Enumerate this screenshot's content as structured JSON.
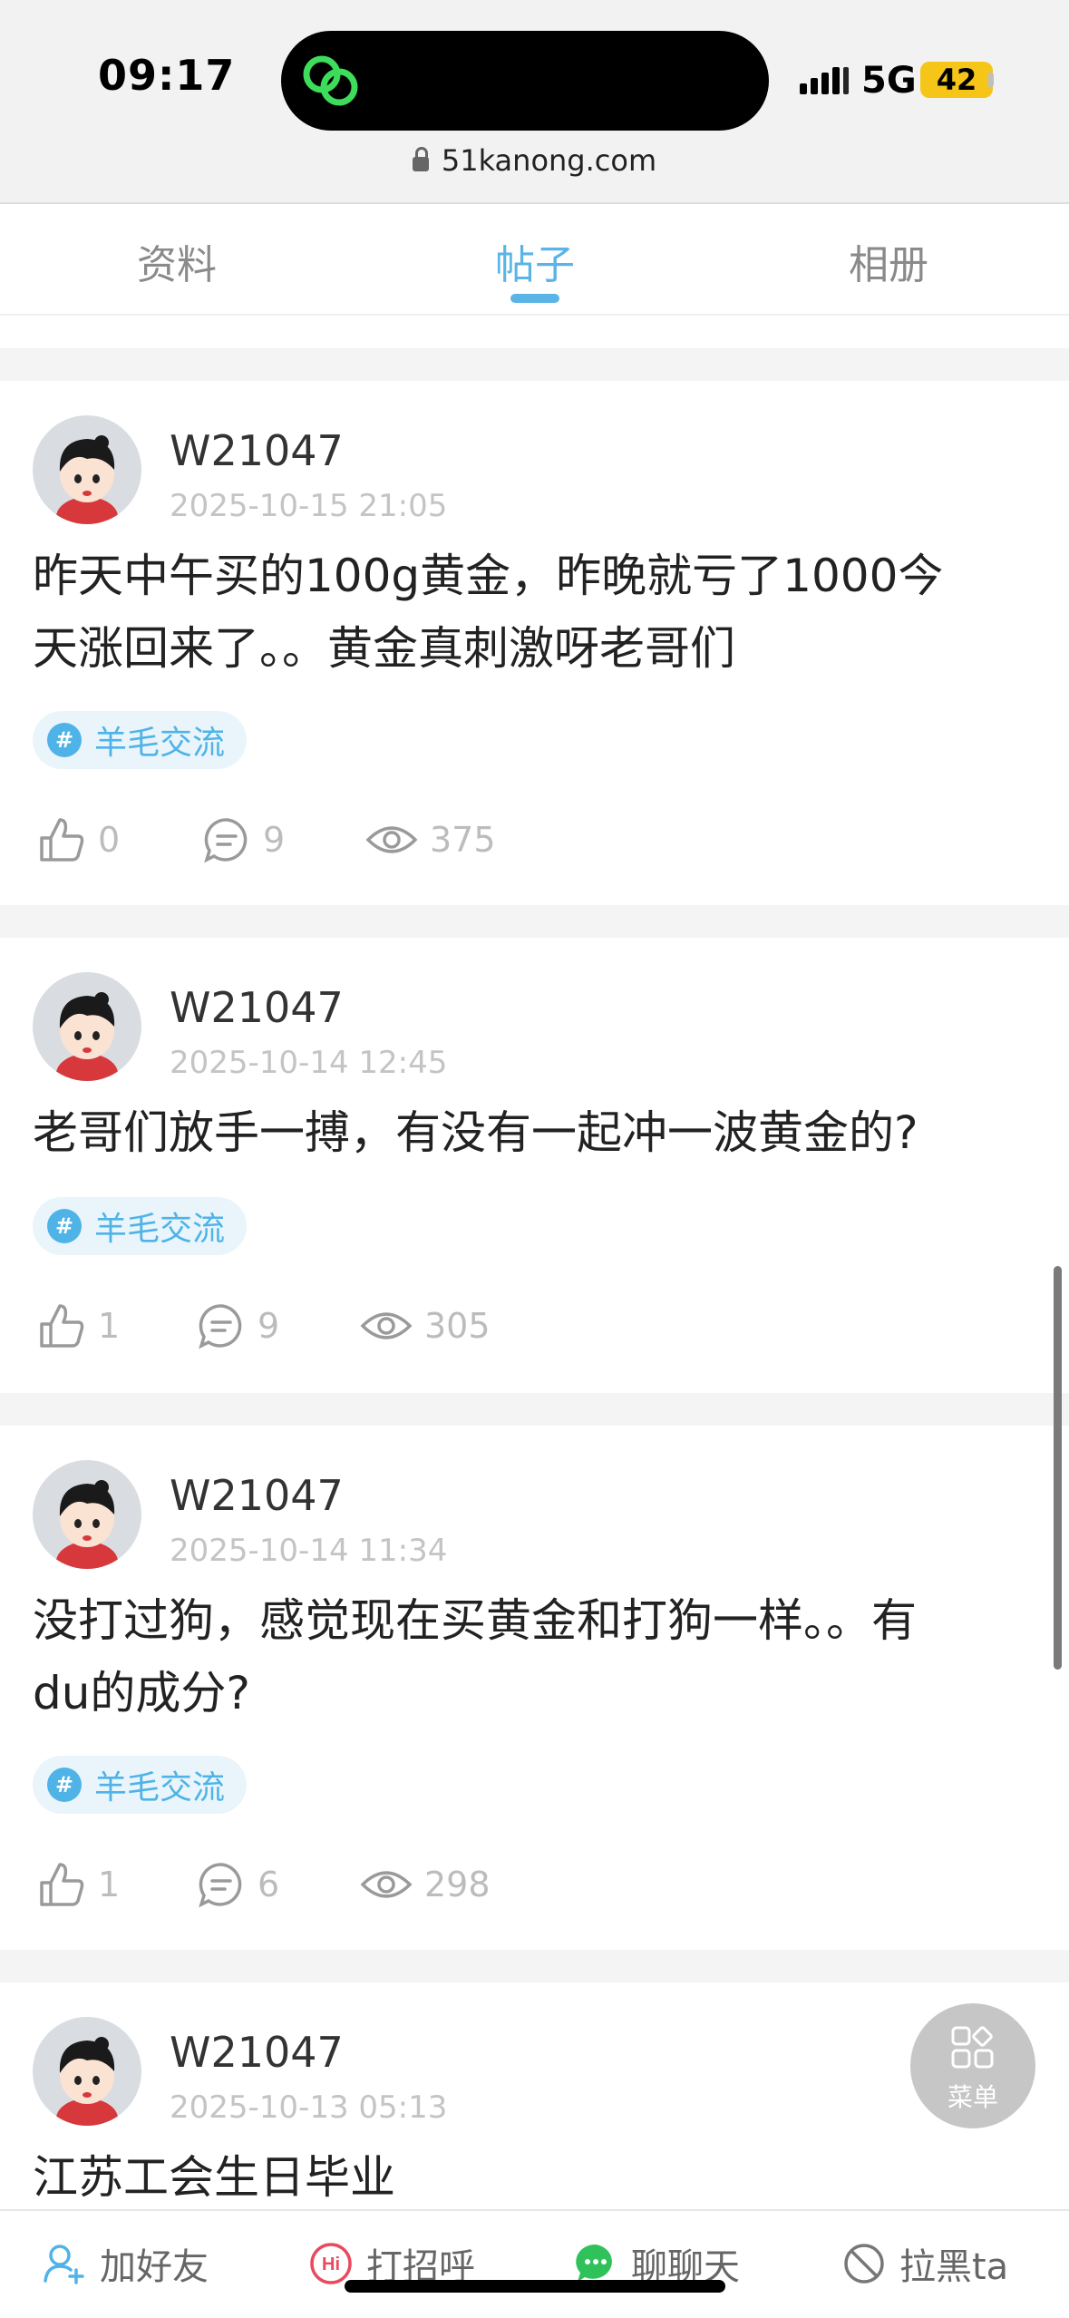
{
  "status": {
    "time": "09:17",
    "network": "5G",
    "battery": "42"
  },
  "browser": {
    "url": "51kanong.com"
  },
  "tabs": [
    {
      "label": "资料",
      "active": false
    },
    {
      "label": "帖子",
      "active": true
    },
    {
      "label": "相册",
      "active": false
    }
  ],
  "posts": [
    {
      "user": "W21047",
      "date": "2025-10-15 21:05",
      "content_lines": [
        "昨天中午买的100g黄金，昨晚就亏了1000今",
        "天涨回来了。。黄金真刺激呀老哥们"
      ],
      "tag": "羊毛交流",
      "likes": "0",
      "comments": "9",
      "views": "375"
    },
    {
      "user": "W21047",
      "date": "2025-10-14 12:45",
      "content_lines": [
        "老哥们放手一搏，有没有一起冲一波黄金的?"
      ],
      "tag": "羊毛交流",
      "likes": "1",
      "comments": "9",
      "views": "305"
    },
    {
      "user": "W21047",
      "date": "2025-10-14 11:34",
      "content_lines": [
        "没打过狗，感觉现在买黄金和打狗一样。。有",
        "du的成分?"
      ],
      "tag": "羊毛交流",
      "likes": "1",
      "comments": "6",
      "views": "298"
    },
    {
      "user": "W21047",
      "date": "2025-10-13 05:13",
      "content_lines": [
        "江苏工会生日毕业"
      ]
    }
  ],
  "fab": {
    "label": "菜单"
  },
  "actions": {
    "add_friend": "加好友",
    "greet": "打招呼",
    "chat": "聊聊天",
    "block": "拉黑ta",
    "greet_badge": "Hi"
  },
  "colors": {
    "accent": "#5ab4e6",
    "tag_bg": "#e9f5fb",
    "chat_green": "#2fc25b",
    "greet_red": "#e84a5f"
  }
}
